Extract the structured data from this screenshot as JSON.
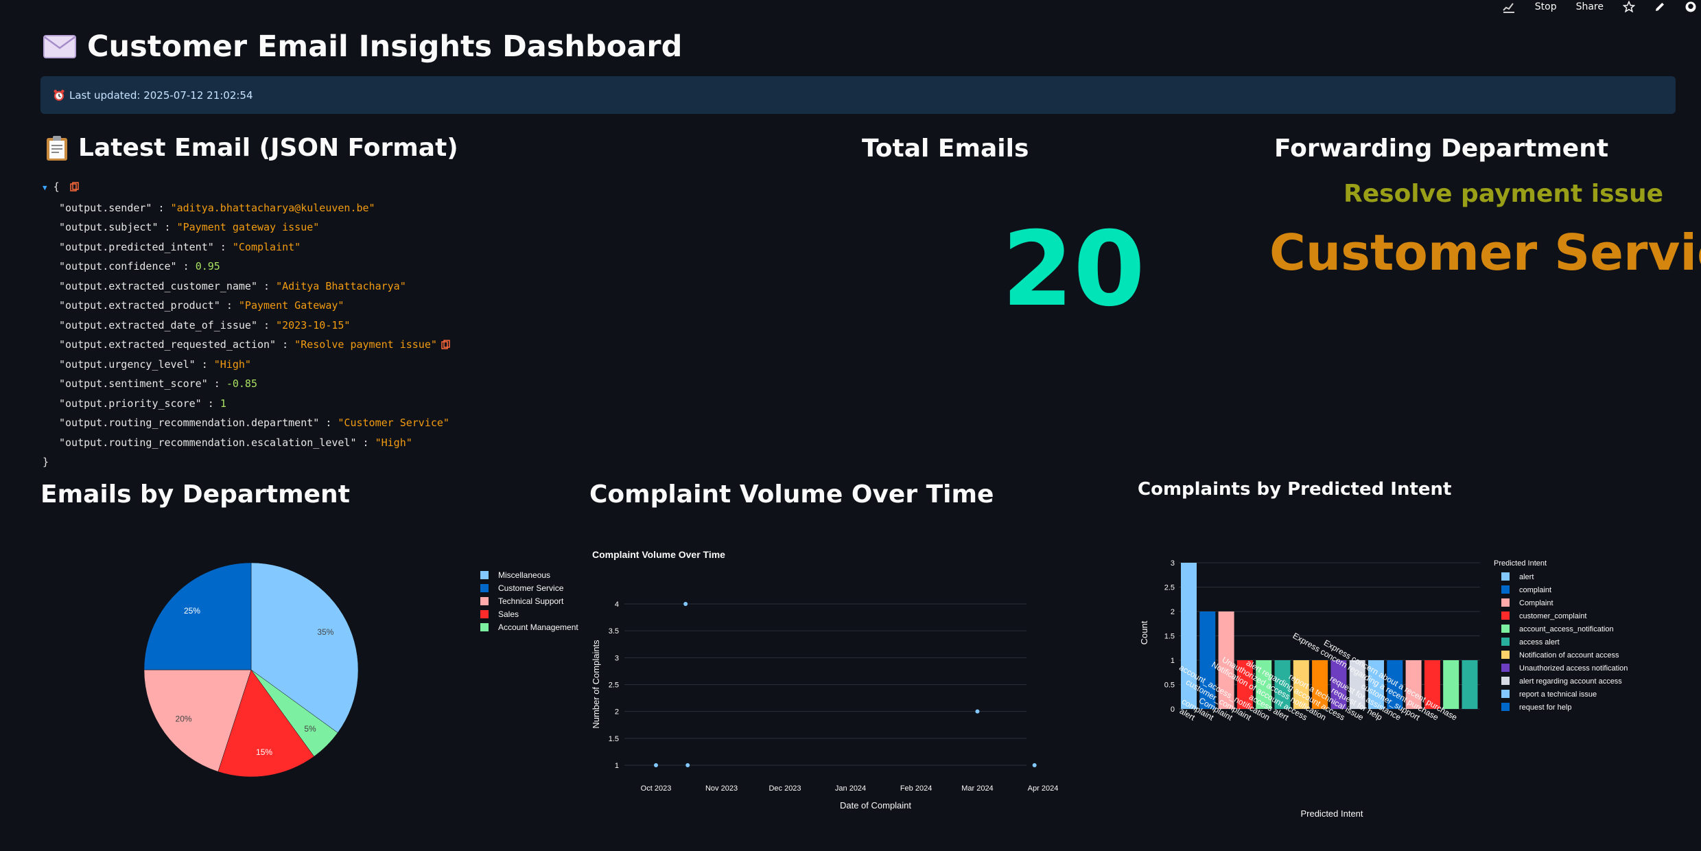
{
  "toolbar": {
    "stop_label": "Stop",
    "share_label": "Share"
  },
  "header": {
    "title": "Customer Email Insights Dashboard",
    "last_updated": "Last updated: 2025-07-12 21:02:54"
  },
  "json_section": {
    "title": "Latest Email (JSON Format)",
    "open_brace": "{",
    "close_brace": "}",
    "fields": [
      {
        "key": "\"output.sender\"",
        "value": "\"aditya.bhattacharya@kuleuven.be\"",
        "type": "string"
      },
      {
        "key": "\"output.subject\"",
        "value": "\"Payment gateway issue\"",
        "type": "string"
      },
      {
        "key": "\"output.predicted_intent\"",
        "value": "\"Complaint\"",
        "type": "string"
      },
      {
        "key": "\"output.confidence\"",
        "value": "0.95",
        "type": "number"
      },
      {
        "key": "\"output.extracted_customer_name\"",
        "value": "\"Aditya Bhattacharya\"",
        "type": "string"
      },
      {
        "key": "\"output.extracted_product\"",
        "value": "\"Payment Gateway\"",
        "type": "string"
      },
      {
        "key": "\"output.extracted_date_of_issue\"",
        "value": "\"2023-10-15\"",
        "type": "string"
      },
      {
        "key": "\"output.extracted_requested_action\"",
        "value": "\"Resolve payment issue\"",
        "type": "string"
      },
      {
        "key": "\"output.urgency_level\"",
        "value": "\"High\"",
        "type": "string"
      },
      {
        "key": "\"output.sentiment_score\"",
        "value": "-0.85",
        "type": "number"
      },
      {
        "key": "\"output.priority_score\"",
        "value": "1",
        "type": "number"
      },
      {
        "key": "\"output.routing_recommendation.department\"",
        "value": "\"Customer Service\"",
        "type": "string"
      },
      {
        "key": "\"output.routing_recommendation.escalation_level\"",
        "value": "\"High\"",
        "type": "string"
      }
    ]
  },
  "total_emails": {
    "title": "Total Emails",
    "value": "20"
  },
  "forwarding": {
    "title": "Forwarding Department",
    "action": "Resolve payment issue",
    "department": "Customer Service"
  },
  "sections": {
    "dept_title": "Emails by Department",
    "volume_title": "Complaint Volume Over Time",
    "intent_title": "Complaints by Predicted Intent"
  },
  "colors": {
    "accent_metric": "#00e4b8",
    "forward_action": "#9a9f18",
    "forward_dept": "#d4860f",
    "info_bg": "#172d43"
  },
  "chart_data": [
    {
      "type": "pie",
      "title": "",
      "legend_position": "right",
      "slices": [
        {
          "label": "Miscellaneous",
          "value": 35,
          "text": "35%",
          "color": "#83c9ff"
        },
        {
          "label": "Account Management",
          "value": 5,
          "text": "5%",
          "color": "#7defa1"
        },
        {
          "label": "Sales",
          "value": 15,
          "text": "15%",
          "color": "#ff2b2b"
        },
        {
          "label": "Technical Support",
          "value": 20,
          "text": "20%",
          "color": "#ffabab"
        },
        {
          "label": "Customer Service",
          "value": 25,
          "text": "25%",
          "color": "#0068c9"
        }
      ],
      "legend": [
        "Miscellaneous",
        "Customer Service",
        "Technical Support",
        "Sales",
        "Account Management"
      ]
    },
    {
      "type": "scatter",
      "title": "Complaint Volume Over Time",
      "xlabel": "Date of Complaint",
      "ylabel": "Number of Complaints",
      "x_ticks": [
        "Oct 2023",
        "Nov 2023",
        "Dec 2023",
        "Jan 2024",
        "Feb 2024",
        "Mar 2024",
        "Apr 2024"
      ],
      "y_ticks": [
        "1",
        "1.5",
        "2",
        "2.5",
        "3",
        "3.5",
        "4"
      ],
      "ylim": [
        1,
        4
      ],
      "grid": true,
      "points": [
        {
          "x": "2023-10-01",
          "y": 1
        },
        {
          "x": "2023-10-15",
          "y": 4
        },
        {
          "x": "2023-10-16",
          "y": 1
        },
        {
          "x": "2024-03-01",
          "y": 2
        },
        {
          "x": "2024-03-28",
          "y": 1
        }
      ]
    },
    {
      "type": "bar",
      "title": "",
      "xlabel": "Predicted Intent",
      "ylabel": "Count",
      "legend_title": "Predicted Intent",
      "legend_position": "right",
      "ylim": [
        0,
        3
      ],
      "y_ticks": [
        "0",
        "0.5",
        "1",
        "1.5",
        "2",
        "2.5",
        "3"
      ],
      "grid": true,
      "categories": [
        {
          "label": "alert",
          "value": 3,
          "color": "#83c9ff"
        },
        {
          "label": "complaint",
          "value": 2,
          "color": "#0068c9"
        },
        {
          "label": "Complaint",
          "value": 2,
          "color": "#ffabab"
        },
        {
          "label": "customer_complaint",
          "value": 1,
          "color": "#ff2b2b"
        },
        {
          "label": "account_access_notification",
          "value": 1,
          "color": "#7defa1"
        },
        {
          "label": "access alert",
          "value": 1,
          "color": "#29b09d"
        },
        {
          "label": "Notification of account access",
          "value": 1,
          "color": "#ffd16a"
        },
        {
          "label": "Unauthorized access notification",
          "value": 1,
          "color": "#ff8700"
        },
        {
          "label": "alert regarding account access",
          "value": 1,
          "color": "#6d3fc0"
        },
        {
          "label": "report a technical issue",
          "value": 1,
          "color": "#d5dae5"
        },
        {
          "label": "request for help",
          "value": 1,
          "color": "#83c9ff"
        },
        {
          "label": "request for assistance",
          "value": 1,
          "color": "#0068c9"
        },
        {
          "label": "customer_support",
          "value": 1,
          "color": "#ffabab"
        },
        {
          "label": "Express concern regarding a recent purchase",
          "value": 1,
          "color": "#ff2b2b"
        },
        {
          "label": "Express concern about a recent purchase",
          "value": 1,
          "color": "#7defa1"
        },
        {
          "label": "",
          "value": 1,
          "color": "#29b09d"
        }
      ],
      "legend": [
        {
          "label": "alert",
          "color": "#83c9ff"
        },
        {
          "label": "complaint",
          "color": "#0068c9"
        },
        {
          "label": "Complaint",
          "color": "#ffabab"
        },
        {
          "label": "customer_complaint",
          "color": "#ff2b2b"
        },
        {
          "label": "account_access_notification",
          "color": "#7defa1"
        },
        {
          "label": "access alert",
          "color": "#29b09d"
        },
        {
          "label": "Notification of account access",
          "color": "#ffd16a"
        },
        {
          "label": "Unauthorized access notification",
          "color": "#6d3fc0"
        },
        {
          "label": "alert regarding account access",
          "color": "#d5dae5"
        },
        {
          "label": "report a technical issue",
          "color": "#83c9ff"
        },
        {
          "label": "request for help",
          "color": "#0068c9"
        }
      ]
    }
  ]
}
